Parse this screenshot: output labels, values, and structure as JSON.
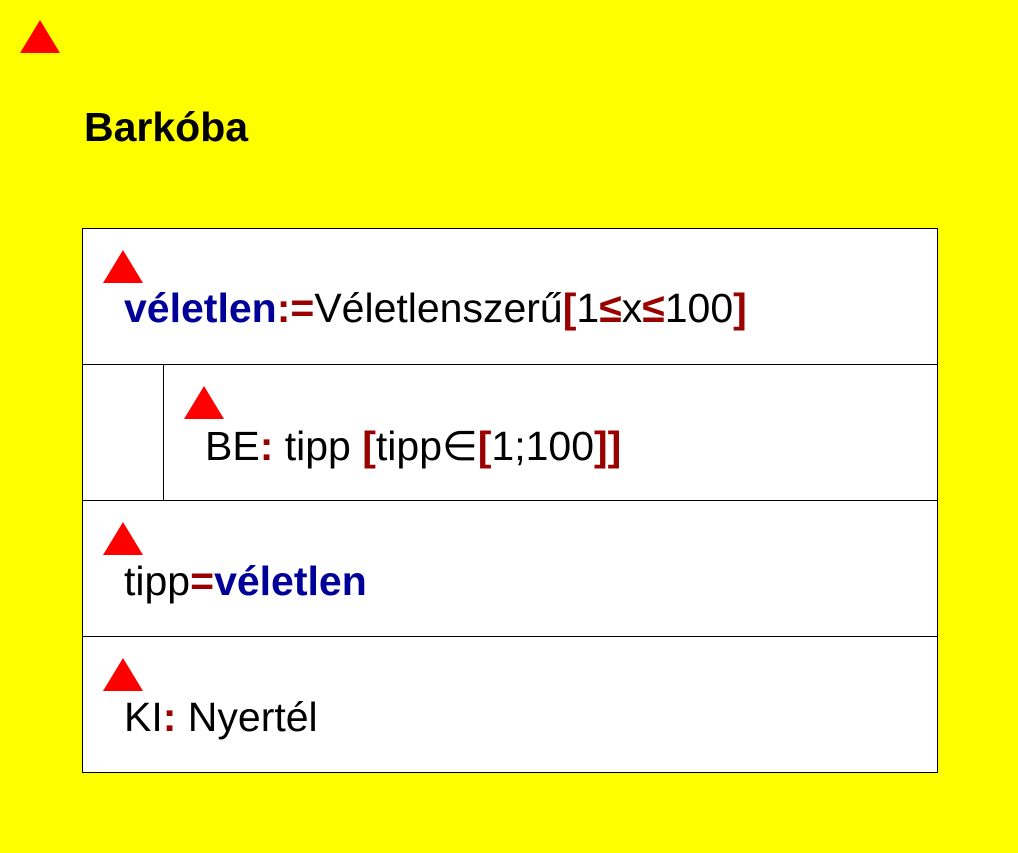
{
  "title": "Barkóba",
  "block1": {
    "var": "véletlen",
    "assign": ":=",
    "func": "Véletlenszerű",
    "lb": "[",
    "one": "1",
    "le1": "≤",
    "x": "x",
    "le2": "≤",
    "hundred": "100",
    "rb": "]"
  },
  "block2": {
    "be": "BE",
    "colon": ":",
    "tipp": " tipp ",
    "lb": "[",
    "tipp2": "tipp∈",
    "lb2": "[",
    "range": "1;100",
    "rb": "]]"
  },
  "block3": {
    "tipp": "tipp",
    "eq": "=",
    "var": "véletlen"
  },
  "block4": {
    "ki": "KI",
    "colon": ":",
    "msg": " Nyertél"
  },
  "colors": {
    "background": "#ffff00",
    "marker": "#ff0000",
    "keyword": "#000099",
    "operator": "#990000"
  }
}
